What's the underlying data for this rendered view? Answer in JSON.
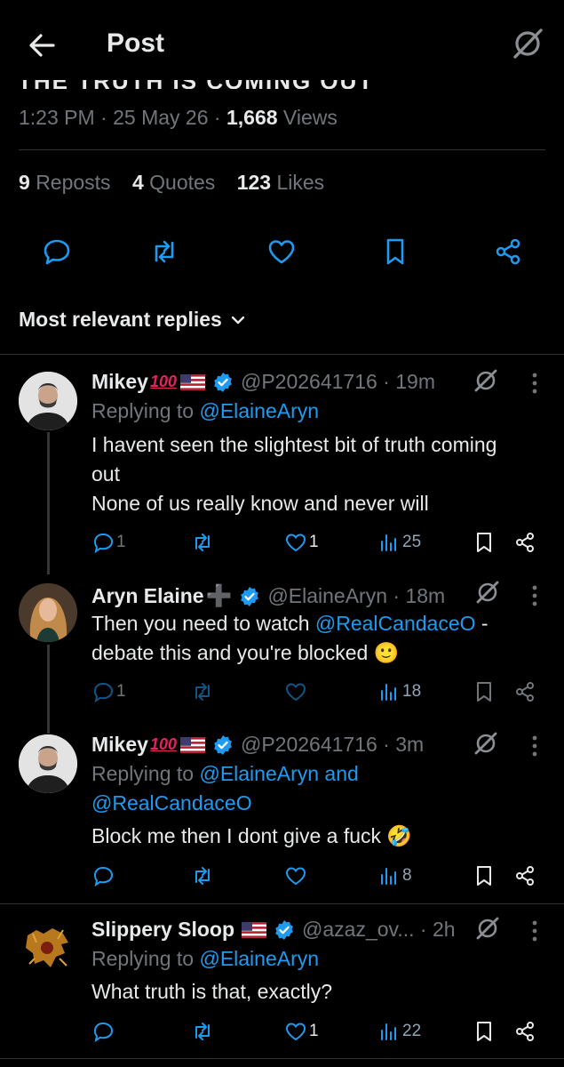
{
  "header": {
    "title": "Post"
  },
  "post": {
    "cut_text": "THE TRUTH IS COMING OUT",
    "time": "1:23 PM",
    "date": "25 May 26",
    "views_count": "1,668",
    "views_label": "Views",
    "reposts_count": "9",
    "reposts_label": "Reposts",
    "quotes_count": "4",
    "quotes_label": "Quotes",
    "likes_count": "123",
    "likes_label": "Likes"
  },
  "replies_sort": {
    "label": "Most relevant replies"
  },
  "replies": [
    {
      "name": "Mikey",
      "emoji": "100",
      "handle": "@P202641716",
      "time": "19m",
      "replying_prefix": "Replying to",
      "replying_to": "@ElaineAryn",
      "text_line1": "I havent seen the slightest bit of truth coming",
      "text_line2": "out",
      "text_line3": "None of us really know and never will",
      "replies": "1",
      "likes": "1",
      "views": "25"
    },
    {
      "name": "Aryn Elaine",
      "emoji": "➕",
      "handle": "@ElaineAryn",
      "time": "18m",
      "text_pre": "Then you need to watch",
      "text_mention": "@RealCandaceO",
      "text_post": " -",
      "text_line2": "debate this and you're blocked",
      "text_emoji": "🙂",
      "replies": "1",
      "likes": "",
      "views": "18"
    },
    {
      "name": "Mikey",
      "emoji": "100",
      "handle": "@P202641716",
      "time": "3m",
      "replying_prefix": "Replying to",
      "replying_to": "@ElaineAryn and",
      "replying_to2": "@RealCandaceO",
      "text_line1": "Block me then I dont give a fuck",
      "text_emoji": "🤣",
      "replies": "",
      "likes": "",
      "views": "8"
    },
    {
      "name": "Slippery Sloop",
      "handle": "@azaz_ov...",
      "time": "2h",
      "replying_prefix": "Replying to",
      "replying_to": "@ElaineAryn",
      "text_line1": "What truth is that, exactly?",
      "replies": "",
      "likes": "1",
      "views": "22"
    }
  ],
  "colors": {
    "accent": "#1d9bf0",
    "muted": "#71767b",
    "text": "#e7e9ea",
    "bg": "#000000"
  }
}
